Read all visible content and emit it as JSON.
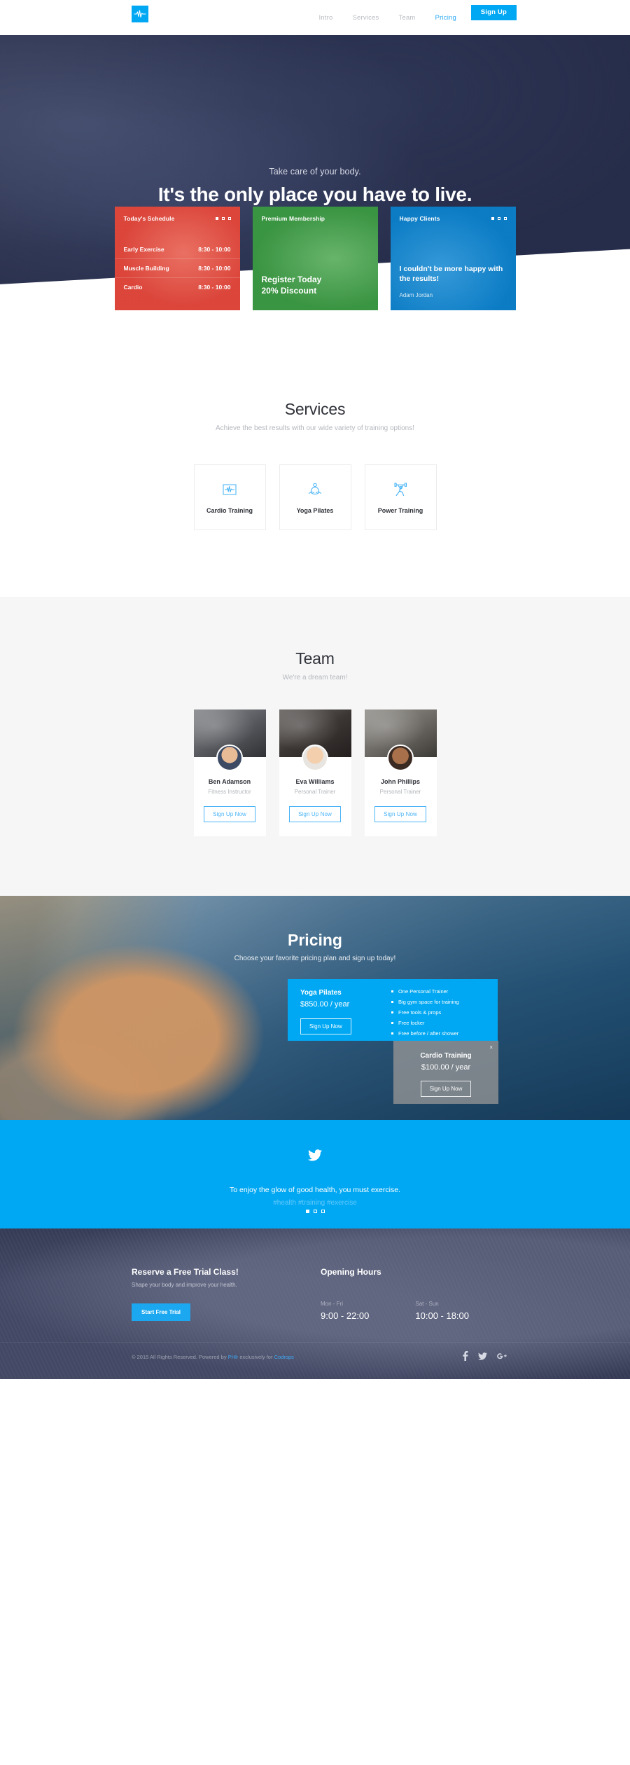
{
  "brand": {
    "logo_icon": "heartbeat-icon",
    "accent": "#00a8f3"
  },
  "nav": {
    "links": [
      {
        "label": "Intro",
        "active": false
      },
      {
        "label": "Services",
        "active": false
      },
      {
        "label": "Team",
        "active": false
      },
      {
        "label": "Pricing",
        "active": true
      }
    ],
    "signup_label": "Sign Up"
  },
  "hero": {
    "subtitle": "Take care of your body.",
    "title": "It's the only place you have to live."
  },
  "cards": {
    "schedule": {
      "title": "Today's Schedule",
      "color": "#e2483d",
      "rows": [
        {
          "name": "Early Exercise",
          "time": "8:30 - 10:00"
        },
        {
          "name": "Muscle Building",
          "time": "8:30 - 10:00"
        },
        {
          "name": "Cardio",
          "time": "8:30 - 10:00"
        }
      ]
    },
    "membership": {
      "title": "Premium Membership",
      "color": "#3e9c46",
      "line1": "Register Today",
      "line2": "20% Discount"
    },
    "clients": {
      "title": "Happy Clients",
      "color": "#0c83cf",
      "quote": "I couldn't be more happy with the results!",
      "author": "Adam Jordan"
    }
  },
  "services": {
    "title": "Services",
    "subtitle": "Achieve the best results with our wide variety of training options!",
    "items": [
      {
        "label": "Cardio Training",
        "icon": "heartbeat-monitor-icon"
      },
      {
        "label": "Yoga Pilates",
        "icon": "meditation-icon"
      },
      {
        "label": "Power Training",
        "icon": "weightlifter-icon"
      }
    ]
  },
  "team": {
    "title": "Team",
    "subtitle": "We're a dream team!",
    "members": [
      {
        "name": "Ben Adamson",
        "role": "Fitness Instructor",
        "cta": "Sign Up Now"
      },
      {
        "name": "Eva Williams",
        "role": "Personal Trainer",
        "cta": "Sign Up Now"
      },
      {
        "name": "John Phillips",
        "role": "Personal Trainer",
        "cta": "Sign Up Now"
      }
    ]
  },
  "pricing": {
    "title": "Pricing",
    "subtitle": "Choose your favorite pricing plan and sign up today!",
    "primary": {
      "name": "Yoga Pilates",
      "price": "$850.00 / year",
      "cta": "Sign Up Now",
      "features": [
        "One Personal Trainer",
        "Big gym space for training",
        "Free tools & props",
        "Free locker",
        "Free before / after shower"
      ]
    },
    "secondary": {
      "name": "Cardio Training",
      "price": "$100.00 / year",
      "cta": "Sign Up Now",
      "close_label": "×"
    }
  },
  "tweet": {
    "icon": "twitter-bird-icon",
    "text": "To enjoy the glow of good health, you must exercise.",
    "tags": "#health #training #exercise",
    "dots": 3
  },
  "footer": {
    "trial": {
      "heading": "Reserve a Free Trial Class!",
      "text": "Shape your body and improve your health.",
      "cta": "Start Free Trial"
    },
    "hours": {
      "heading": "Opening Hours",
      "items": [
        {
          "label": "Mon - Fri",
          "value": "9:00 - 22:00"
        },
        {
          "label": "Sat - Sun",
          "value": "10:00 - 18:00"
        }
      ]
    },
    "copyright_prefix": "© 2015 All Rights Reserved. Powered by ",
    "copyright_link1": "PHlr",
    "copyright_middle": " exclusively for ",
    "copyright_link2": "Codrops",
    "socials": [
      {
        "icon": "facebook-icon",
        "glyph": "f"
      },
      {
        "icon": "twitter-icon",
        "glyph": "ᵗ"
      },
      {
        "icon": "google-plus-icon",
        "glyph": "g+"
      }
    ]
  }
}
